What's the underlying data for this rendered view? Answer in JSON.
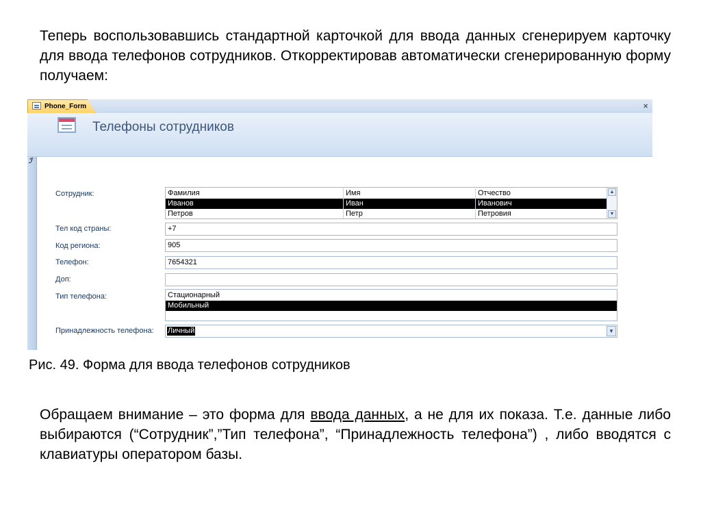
{
  "intro_text": "Теперь воспользовавшись стандартной карточкой для ввода данных сгенерируем карточку для ввода телефонов сотрудников. Откорректировав автоматически сгенерированную форму получаем:",
  "window": {
    "tab_label": "Phone_Form",
    "close_glyph": "×",
    "form_title": "Телефоны сотрудников",
    "record_selector_glyph": "ℐ"
  },
  "fields": {
    "employee": {
      "label": "Сотрудник:",
      "columns": [
        "Фамилия",
        "Имя",
        "Отчество"
      ],
      "rows": [
        [
          "Иванов",
          "Иван",
          "Иванович"
        ],
        [
          "Петров",
          "Петр",
          "Петровия"
        ]
      ],
      "selected_row": 0
    },
    "country_code": {
      "label": "Тел код страны:",
      "value": "+7"
    },
    "region_code": {
      "label": "Код региона:",
      "value": "905"
    },
    "phone": {
      "label": "Телефон:",
      "value": "7654321"
    },
    "extension": {
      "label": "Доп:",
      "value": ""
    },
    "phone_type": {
      "label": "Тип телефона:",
      "options": [
        "Стационарный",
        "Мобильный"
      ],
      "selected": "Мобильный"
    },
    "ownership": {
      "label": "Принадлежность телефона:",
      "value": "Личный"
    }
  },
  "caption": "Рис. 49. Форма для ввода телефонов сотрудников",
  "note": {
    "before": "Обращаем внимание – это форма для ",
    "underlined": "ввода данных",
    "after": ", а не для их показа. Т.е. данные либо выбираются (“Сотрудник”,”Тип телефона”, “Принадлежность телефона”) , либо вводятся с клавиатуры оператором базы."
  },
  "colors": {
    "header_bg": "#cfdff2",
    "label_text": "#17365d",
    "title_text": "#3d5578",
    "tab_bg": "#ffd36b"
  },
  "icons": [
    "form-tab-icon",
    "form-header-icon",
    "close-icon",
    "scroll-up-icon",
    "scroll-down-icon",
    "dropdown-arrow-icon",
    "record-pencil-icon"
  ]
}
